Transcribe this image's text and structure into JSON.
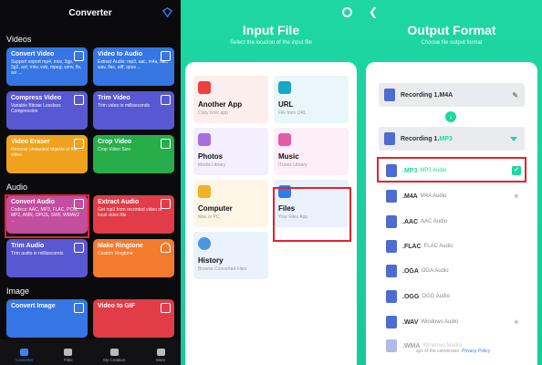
{
  "p1": {
    "header": "Converter",
    "sections": [
      "Videos",
      "Audio",
      "Image"
    ],
    "cards": [
      {
        "title": "Convert Video",
        "desc": "Support export mp4, mov, 3gp, 3g2, asf, mkv, vob, mpeg, wmv, flv, avi ...",
        "color": "#3576e4"
      },
      {
        "title": "Video to Audio",
        "desc": "Extract Audio: mp3, aac, m4a, flac, wav, flac, aiff, opus ...",
        "color": "#3576e4"
      },
      {
        "title": "Compress Video",
        "desc": "Variable Bitrate Lossless Compression",
        "color": "#5958d3"
      },
      {
        "title": "Trim Video",
        "desc": "Trim video in milliseconds",
        "color": "#5958d3"
      },
      {
        "title": "Video Eraser",
        "desc": "Remove unwanted objects of the video",
        "color": "#f0a21c"
      },
      {
        "title": "Crop Video",
        "desc": "Crop Video Size",
        "color": "#27ae4b"
      },
      {
        "title": "Convert Audio",
        "desc": "Codecs: AAC, MP3, FLAC, PCM, MP2, AMR, OPUS, SWF, WMAV2 ...",
        "color": "#c34d9f"
      },
      {
        "title": "Extract Audio",
        "desc": "Get mp3 from recorded video or local video file",
        "color": "#e23c48"
      },
      {
        "title": "Trim Audio",
        "desc": "Trim audio in milliseconds",
        "color": "#5958d3"
      },
      {
        "title": "Make Ringtone",
        "desc": "Custom Ringtone",
        "color": "#f27b2d"
      },
      {
        "title": "Convert Image",
        "desc": "",
        "color": "#3576e4"
      },
      {
        "title": "Video to GIF",
        "desc": "",
        "color": "#e23c48"
      }
    ],
    "tabs": [
      "Converter",
      "Files",
      "My Creation",
      "More"
    ]
  },
  "p2": {
    "title": "Input File",
    "subtitle": "Select the location of the input file",
    "items": [
      {
        "title": "Another App",
        "desc": "Copy from app",
        "bg": "#fdeeee",
        "icon": "#ee4040"
      },
      {
        "title": "URL",
        "desc": "File from URL",
        "bg": "#eaf7fa",
        "icon": "#1aa6c5"
      },
      {
        "title": "Photos",
        "desc": "Media Library",
        "bg": "#f3effd",
        "icon": "#a66fe0"
      },
      {
        "title": "Music",
        "desc": "iTunes Library",
        "bg": "#fdeef7",
        "icon": "#e45aa4"
      },
      {
        "title": "Computer",
        "desc": "Mac or PC",
        "bg": "#fdf6e6",
        "icon": "#f0b12a"
      },
      {
        "title": "Files",
        "desc": "Your Files App",
        "bg": "#e8f1fc",
        "icon": "#2f7ee6"
      },
      {
        "title": "History",
        "desc": "Browse Converted Files",
        "bg": "#eaf2fb",
        "icon": "#4a96e0"
      }
    ]
  },
  "p3": {
    "title": "Output Format",
    "subtitle": "Choose file output format",
    "source": "Recording 1.M4A",
    "target_name": "Recording 1.",
    "target_ext": "MP3",
    "formats": [
      {
        "ext": ".MP3",
        "name": "MP3 Audio"
      },
      {
        "ext": ".M4A",
        "name": "M4A Audio"
      },
      {
        "ext": ".AAC",
        "name": "AAC Audio"
      },
      {
        "ext": ".FLAC",
        "name": "FLAC Audio"
      },
      {
        "ext": ".OGA",
        "name": "OGA Audio"
      },
      {
        "ext": ".OGG",
        "name": "OGG Audio"
      },
      {
        "ext": ".WAV",
        "name": "Windows Audio"
      },
      {
        "ext": ".WMA",
        "name": "Windows Media"
      }
    ],
    "footer_text": "ays of the conversion.",
    "footer_link": "Privacy Policy",
    "accent": "#1ed7a2"
  }
}
